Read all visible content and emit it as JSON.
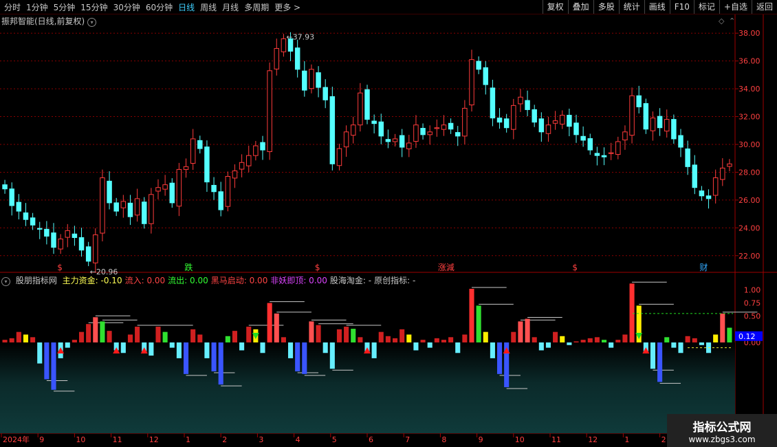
{
  "toolbar": {
    "periods": [
      "分时",
      "1分钟",
      "5分钟",
      "15分钟",
      "30分钟",
      "60分钟",
      "日线",
      "周线",
      "月线",
      "多周期",
      "更多 >"
    ],
    "active_period": "日线",
    "buttons": [
      "复权",
      "叠加",
      "多股",
      "统计",
      "画线",
      "F10",
      "标记",
      "+自选",
      "返回"
    ]
  },
  "main_title": "振邦智能(日线,前复权)",
  "indicator": {
    "name": "股朋指标网",
    "fields": [
      {
        "label": "主力资金:",
        "value": "-0.10",
        "color": "#ffff55"
      },
      {
        "label": "流入:",
        "value": "0.00",
        "color": "#ff4444"
      },
      {
        "label": "流出:",
        "value": "0.00",
        "color": "#33ff33"
      },
      {
        "label": "黑马启动:",
        "value": "0.00",
        "color": "#ff4444"
      },
      {
        "label": "非妖即顶:",
        "value": "0.00",
        "color": "#dd44ff"
      },
      {
        "label": "股海淘金:",
        "value": "-",
        "color": "#c8c8c8"
      },
      {
        "label": "原创指标:",
        "value": "-",
        "color": "#c8c8c8"
      }
    ],
    "current_value": "0.12"
  },
  "chart_data": [
    {
      "type": "candlestick",
      "ylim": [
        21,
        39
      ],
      "y_ticks": [
        22.0,
        24.0,
        26.0,
        28.0,
        30.0,
        32.0,
        34.0,
        36.0,
        38.0
      ],
      "annotations": [
        {
          "label": "37.93",
          "kind": "high"
        },
        {
          "label": "20.96",
          "kind": "low"
        }
      ],
      "event_markers": [
        "$",
        "跌",
        "$",
        "涨減",
        "$",
        "财"
      ],
      "grid": true,
      "closes": [
        26.8,
        25.6,
        25.2,
        24.6,
        24.2,
        23.9,
        23.4,
        22.6,
        23.2,
        23.8,
        23.3,
        22.4,
        21.6,
        23.5,
        27.6,
        25.8,
        25.2,
        25.9,
        24.8,
        26.1,
        24.3,
        26.4,
        26.9,
        27.1,
        25.8,
        28.2,
        28.4,
        30.4,
        29.7,
        27.3,
        26.6,
        25.3,
        27.7,
        28.1,
        28.7,
        29.2,
        29.9,
        29.6,
        35.3,
        36.9,
        37.6,
        36.7,
        35.4,
        33.9,
        35.4,
        34.1,
        33.2,
        28.6,
        29.7,
        30.9,
        31.4,
        33.7,
        31.8,
        31.5,
        30.6,
        30.2,
        30.4,
        29.8,
        30.1,
        31.4,
        30.7,
        30.9,
        31.2,
        31.4,
        31.1,
        30.6,
        32.6,
        36.1,
        35.4,
        34.3,
        31.9,
        31.6,
        31.2,
        32.8,
        33.4,
        32.5,
        31.6,
        30.9,
        31.4,
        31.7,
        32.1,
        31.3,
        30.7,
        30.3,
        29.6,
        29.2,
        29.1,
        29.4,
        30.2,
        30.9,
        33.5,
        32.7,
        31.1,
        31.9,
        31.2,
        31.8,
        30.4,
        29.8,
        28.4,
        26.9,
        26.3,
        26.1,
        27.6,
        28.3,
        28.6
      ],
      "sub_ylim": [
        -1.7,
        1.15
      ],
      "sub_y_ticks": [
        0.0,
        0.5,
        0.75,
        1.0
      ],
      "x_axis_labels": [
        "2024年",
        "9",
        "10",
        "11",
        "12",
        "1",
        "2",
        "3",
        "4",
        "5",
        "6",
        "7",
        "8",
        "9",
        "10",
        "11",
        "12",
        "1",
        "2",
        "3"
      ],
      "sub_series": [
        0.05,
        0.08,
        0.2,
        0.15,
        0.1,
        -0.4,
        -0.7,
        -0.9,
        -0.3,
        -0.1,
        0.05,
        0.2,
        0.35,
        0.48,
        0.4,
        0.22,
        -0.15,
        -0.2,
        0.15,
        0.3,
        -0.18,
        -0.25,
        0.3,
        0.2,
        -0.1,
        -0.3,
        -0.6,
        0.25,
        0.15,
        -0.3,
        -0.55,
        -0.8,
        0.12,
        0.22,
        -0.15,
        0.3,
        0.25,
        -0.2,
        0.75,
        0.55,
        0.1,
        -0.3,
        -0.55,
        -0.6,
        0.4,
        0.33,
        -0.2,
        -0.5,
        0.25,
        0.3,
        0.26,
        0.1,
        -0.2,
        -0.3,
        0.2,
        0.12,
        0.08,
        0.25,
        0.15,
        -0.15,
        0.05,
        -0.1,
        0.08,
        0.05,
        0.1,
        -0.2,
        0.15,
        1.02,
        0.7,
        0.2,
        -0.3,
        -0.6,
        -0.85,
        0.2,
        0.4,
        0.45,
        0.1,
        -0.15,
        -0.1,
        0.2,
        0.12,
        -0.05,
        0.02,
        0.05,
        0.08,
        0.1,
        0.05,
        -0.1,
        0.05,
        0.15,
        1.12,
        0.7,
        -0.2,
        -0.5,
        -0.75,
        0.1,
        -0.1,
        -0.2,
        0.12,
        0.08,
        -0.05,
        -0.2,
        0.15,
        0.55,
        0.28
      ]
    }
  ],
  "watermark": {
    "line1": "指标公式网",
    "line2": "www.zbgs3.com"
  }
}
